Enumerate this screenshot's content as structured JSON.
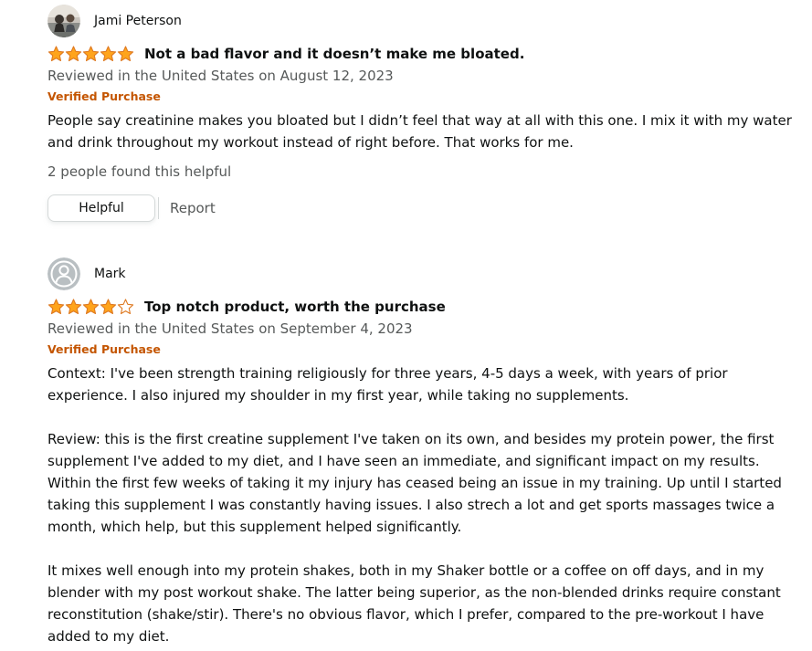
{
  "reviews": [
    {
      "author": "Jami Peterson",
      "avatar_icon": "user-photo-avatar",
      "rating": 5,
      "max_rating": 5,
      "title": "Not a bad flavor and it doesn’t make me bloated.",
      "date": "Reviewed in the United States on August 12, 2023",
      "verified": "Verified Purchase",
      "body": [
        "People say creatinine makes you bloated but I didn’t feel that way at all with this one. I mix it with my water and drink throughout my workout instead of right before. That works for me."
      ],
      "helpful_count": "2 people found this helpful",
      "helpful_label": "Helpful",
      "report_label": "Report"
    },
    {
      "author": "Mark",
      "avatar_icon": "default-user-avatar-icon",
      "rating": 4,
      "max_rating": 5,
      "title": "Top notch product, worth the purchase",
      "date": "Reviewed in the United States on September 4, 2023",
      "verified": "Verified Purchase",
      "body": [
        "Context: I've been strength training religiously for three years, 4-5 days a week, with years of prior experience. I also injured my shoulder in my first year, while taking no supplements.",
        "Review: this is the first creatine supplement I've taken on its own, and besides my protein power, the first supplement I've added to my diet, and I have seen an immediate, and significant impact on my results. Within the first few weeks of taking it my injury has ceased being an issue in my training. Up until I started taking this supplement I was constantly having issues. I also strech a lot and get sports massages twice a month, which help, but this supplement helped significantly.",
        "It mixes well enough into my protein shakes, both in my Shaker bottle or a coffee on off days, and in my blender with my post workout shake. The latter being superior, as the non-blended drinks require constant reconstitution (shake/stir). There's no obvious flavor, which I prefer, compared to the pre-workout I have added to my diet."
      ]
    }
  ],
  "colors": {
    "star": "#ffa41c",
    "star_outline": "#de7921",
    "verified": "#c45500",
    "secondary_text": "#565959",
    "primary_text": "#0f1111"
  }
}
